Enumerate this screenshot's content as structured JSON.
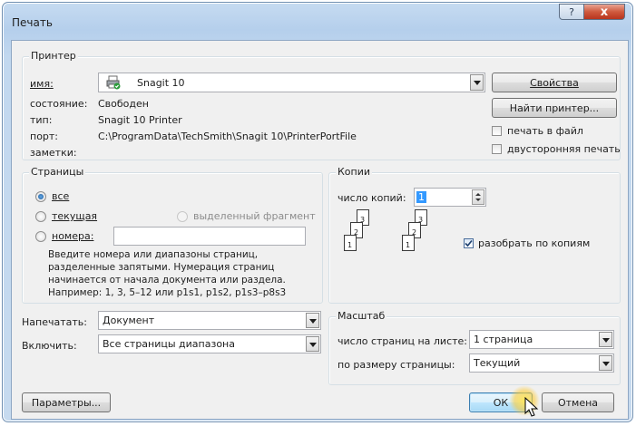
{
  "window": {
    "title": "Печать",
    "help_label": "?",
    "close_label": "x"
  },
  "printer": {
    "legend": "Принтер",
    "name_label": "имя:",
    "name_value": "Snagit 10",
    "status_label": "состояние:",
    "status_value": "Свободен",
    "type_label": "тип:",
    "type_value": "Snagit 10 Printer",
    "port_label": "порт:",
    "port_value": "C:\\ProgramData\\TechSmith\\Snagit 10\\PrinterPortFile",
    "comments_label": "заметки:",
    "properties_button": "Свойства",
    "find_button": "Найти принтер...",
    "print_to_file_label": "печать в файл",
    "duplex_label": "двусторонняя печать"
  },
  "pages": {
    "legend": "Страницы",
    "all_label": "все",
    "current_label": "текущая",
    "selection_label": "выделенный фрагмент",
    "numbers_label": "номера:",
    "numbers_value": "",
    "hint": "Введите номера или диапазоны страниц, разделенные запятыми. Нумерация страниц начинается от начала документа или раздела. Например: 1, 3, 5–12 или p1s1, p1s2, p1s3–p8s3"
  },
  "copies": {
    "legend": "Копии",
    "count_label": "число копий:",
    "count_value": "1",
    "collate_label": "разобрать по копиям",
    "page_numbers": [
      "1",
      "2",
      "3"
    ]
  },
  "print_what": {
    "label": "Напечатать:",
    "value": "Документ"
  },
  "include": {
    "label": "Включить:",
    "value": "Все страницы диапазона"
  },
  "zoom": {
    "legend": "Масштаб",
    "pages_per_sheet_label": "число страниц на листе:",
    "pages_per_sheet_value": "1 страница",
    "scale_label": "по размеру страницы:",
    "scale_value": "Текущий"
  },
  "buttons": {
    "options": "Параметры...",
    "ok": "ОК",
    "cancel": "Отмена"
  },
  "colors": {
    "accent": "#3c7fb1",
    "title_bar": "#b5cfec",
    "close": "#cf5a3e"
  }
}
